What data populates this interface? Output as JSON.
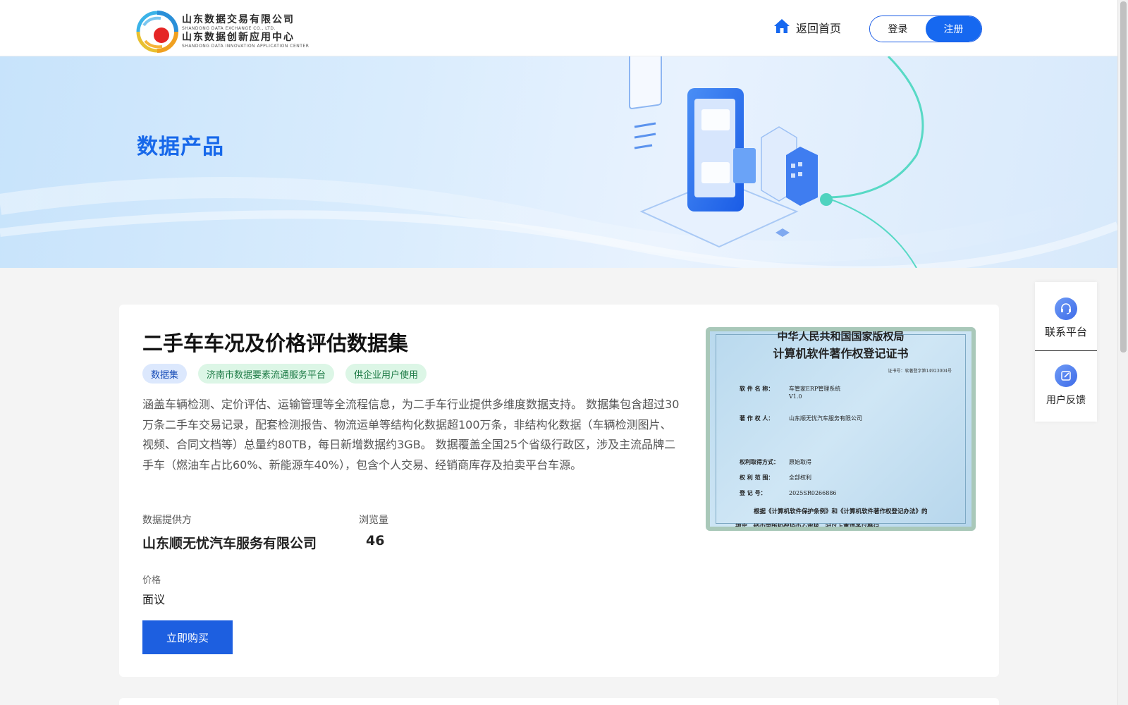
{
  "header": {
    "logo": {
      "line1_cn": "山东数据交易有限公司",
      "line1_en": "SHANDONG DATA EXCHANGE CO., LTD.",
      "line2_cn": "山东数据创新应用中心",
      "line2_en": "SHANDONG DATA INNOVATION APPLICATION CENTER"
    },
    "home_label": "返回首页",
    "login_label": "登录",
    "register_label": "注册"
  },
  "banner": {
    "title": "数据产品"
  },
  "product": {
    "title": "二手车车况及价格评估数据集",
    "tags": [
      "数据集",
      "济南市数据要素流通服务平台",
      "供企业用户使用"
    ],
    "description": "涵盖车辆检测、定价评估、运输管理等全流程信息，为二手车行业提供多维度数据支持。 数据集包含超过30万条二手车交易记录，配套检测报告、物流运单等结构化数据超100万条，非结构化数据（车辆检测图片、视频、合同文档等）总量约80TB，每日新增数据约3GB。 数据覆盖全国25个省级行政区，涉及主流品牌二手车（燃油车占比60%、新能源车40%），包含个人交易、经销商库存及拍卖平台车源。",
    "provider_label": "数据提供方",
    "provider_value": "山东顺无忧汽车服务有限公司",
    "views_label": "浏览量",
    "views_value": "46",
    "price_label": "价格",
    "price_value": "面议",
    "buy_label": "立即购买"
  },
  "certificate": {
    "title_top": "中华人民共和国国家版权局",
    "title_main": "计算机软件著作权登记证书",
    "cert_no": "证书号：软著登字第14923004号",
    "rows": [
      {
        "label": "软 件 名 称：",
        "value": "车管家ERP管理系统"
      },
      {
        "label": "",
        "value": "V1.0"
      },
      {
        "label": "著 作 权 人：",
        "value": "山东顺无忧汽车服务有限公司"
      },
      {
        "label": "权利取得方式：",
        "value": "原始取得"
      },
      {
        "label": "权 利 范 围：",
        "value": "全部权利"
      },
      {
        "label": "登   记   号：",
        "value": "2025SR0266886"
      }
    ],
    "footer1": "根据《计算机软件保护条例》和《计算机软件著作权登记办法》的",
    "footer2": "规定，经中国版权保护中心审核，对以上事项予以登记。"
  },
  "side_widget": {
    "contact_label": "联系平台",
    "feedback_label": "用户反馈"
  },
  "colors": {
    "brand_blue": "#1668f0",
    "banner_title": "#1768ea",
    "tag_blue_bg": "#dce8fd",
    "tag_green_bg": "#dcf6e6"
  }
}
